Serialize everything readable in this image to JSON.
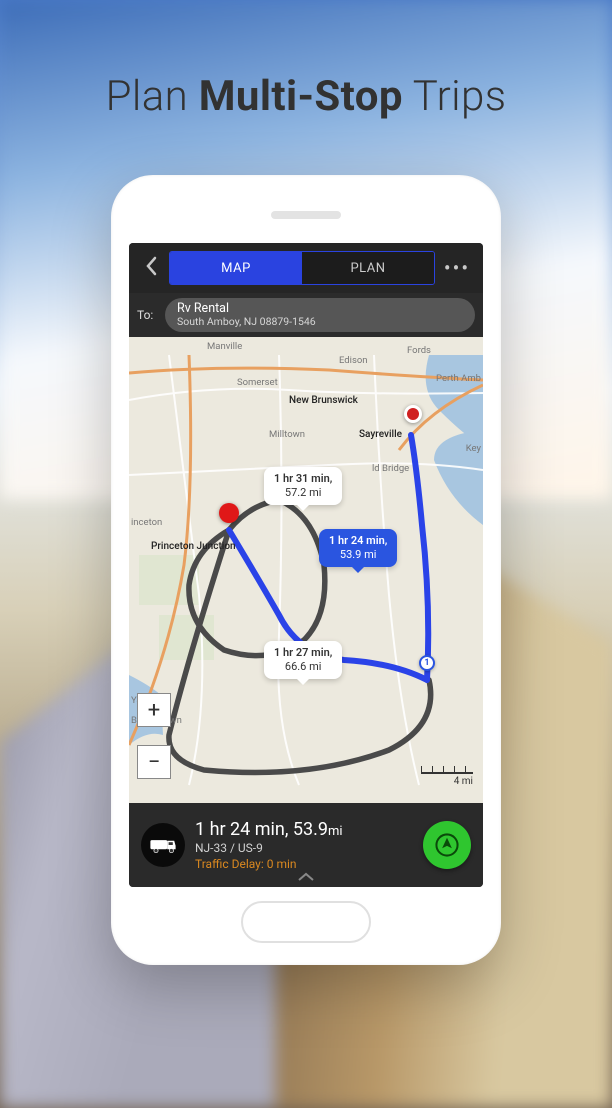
{
  "headline": {
    "pre": "Plan ",
    "bold": "Multi-Stop",
    "post": " Trips"
  },
  "topbar": {
    "tabs": {
      "map": "MAP",
      "plan": "PLAN"
    }
  },
  "destination": {
    "to_label": "To:",
    "title": "Rv Rental",
    "subtitle": "South Amboy, NJ 08879-1546"
  },
  "map_labels": {
    "manville": "Manville",
    "somerset": "Somerset",
    "edison": "Edison",
    "fords": "Fords",
    "perth_amboy": "Perth Amb",
    "new_brunswick": "New Brunswick",
    "milltown": "Milltown",
    "sayreville": "Sayreville",
    "key": "Key",
    "old_bridge": "ld Bridge",
    "princeton": "inceton",
    "princeton_junction": "Princeton Junction",
    "yardville": "Yardville",
    "bordentown": "Bordentown"
  },
  "routes": {
    "alt1": {
      "time": "1 hr 31 min,",
      "dist": "57.2 mi"
    },
    "primary": {
      "time": "1 hr 24 min,",
      "dist": "53.9 mi"
    },
    "alt2": {
      "time": "1 hr 27 min,",
      "dist": "66.6 mi"
    }
  },
  "waypoint_number": "1",
  "scale": "4 mi",
  "summary": {
    "time": "1 hr 24 min,",
    "dist_value": "53.9",
    "dist_unit": "mi",
    "via": "NJ-33 / US-9",
    "traffic": "Traffic Delay: 0 min"
  }
}
